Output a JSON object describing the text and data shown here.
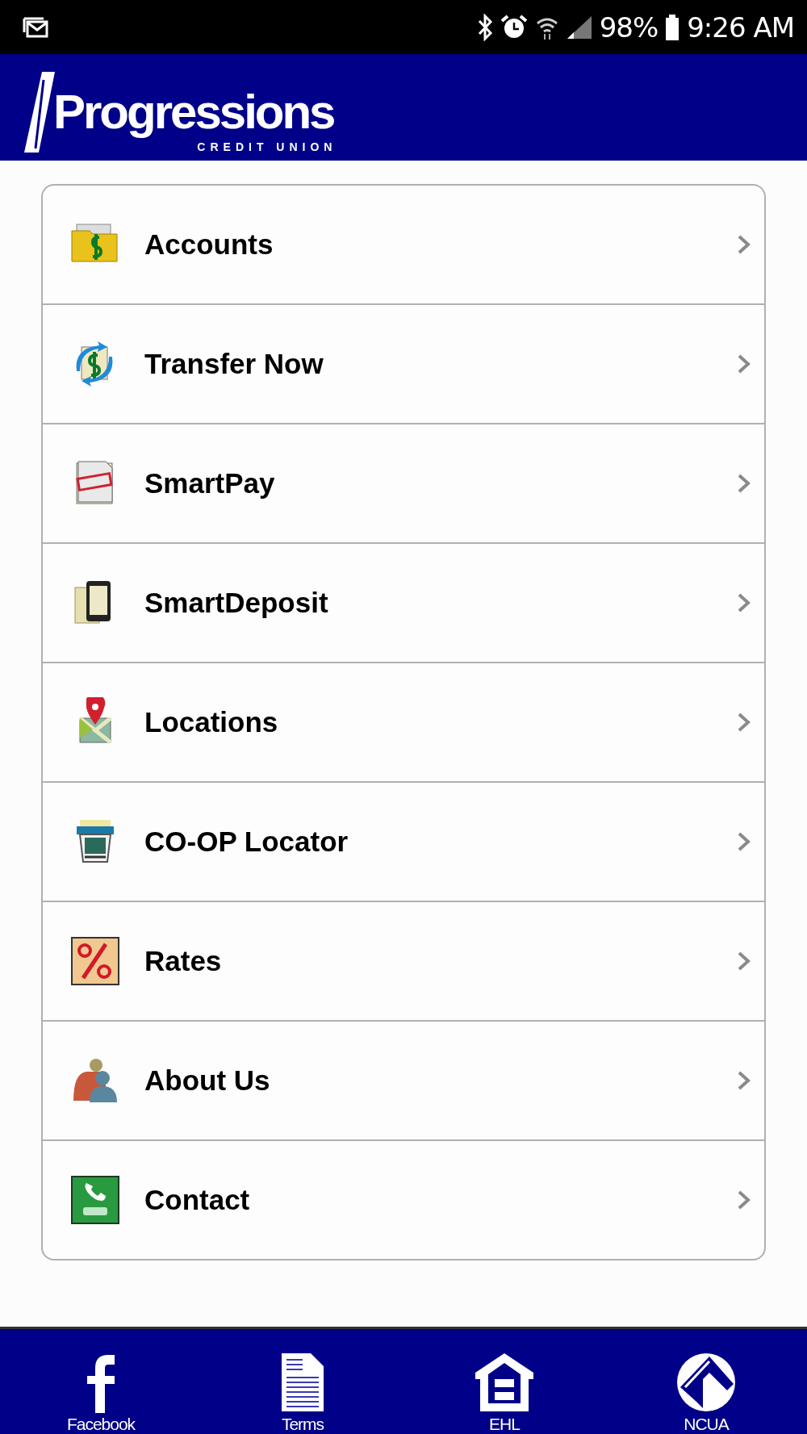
{
  "status_bar": {
    "battery": "98%",
    "time": "9:26 AM"
  },
  "header": {
    "logo_name": "Progressions",
    "logo_sub": "CREDIT UNION"
  },
  "menu": [
    {
      "label": "Accounts",
      "kind": "folder"
    },
    {
      "label": "Transfer Now",
      "kind": "transfer"
    },
    {
      "label": "SmartPay",
      "kind": "paid"
    },
    {
      "label": "SmartDeposit",
      "kind": "phone"
    },
    {
      "label": "Locations",
      "kind": "map"
    },
    {
      "label": "CO-OP Locator",
      "kind": "atm"
    },
    {
      "label": "Rates",
      "kind": "percent"
    },
    {
      "label": "About Us",
      "kind": "people"
    },
    {
      "label": "Contact",
      "kind": "call"
    }
  ],
  "footer": [
    {
      "label": "Facebook",
      "kind": "facebook"
    },
    {
      "label": "Terms",
      "kind": "document"
    },
    {
      "label": "EHL",
      "kind": "house"
    },
    {
      "label": "NCUA",
      "kind": "ncua"
    }
  ]
}
